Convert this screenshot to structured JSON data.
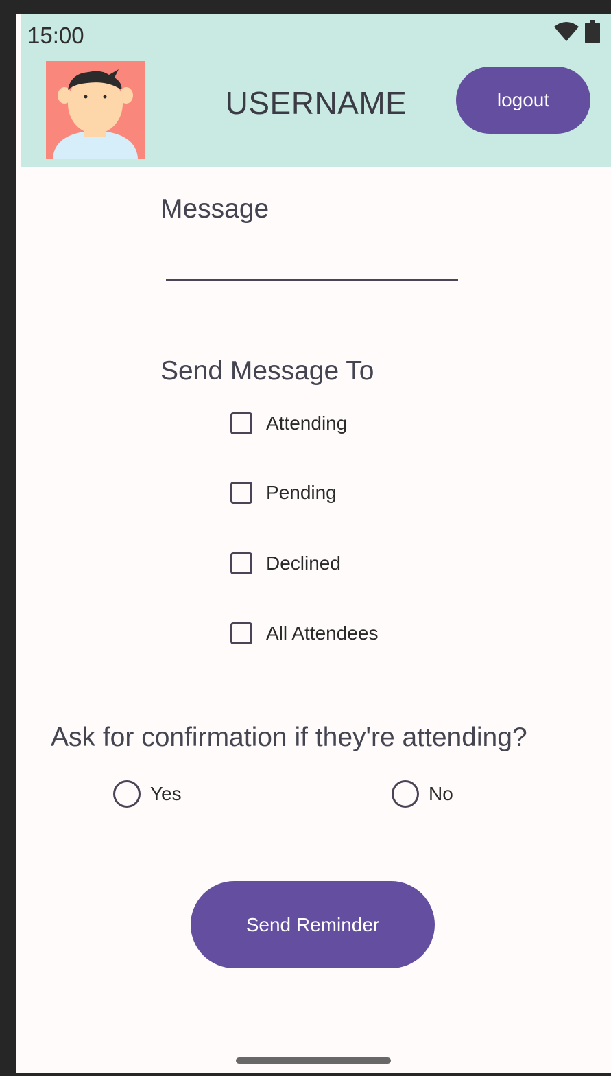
{
  "status_bar": {
    "time": "15:00",
    "icons": [
      "wifi-icon",
      "battery-icon"
    ]
  },
  "header": {
    "username": "USERNAME",
    "logout_label": "logout",
    "avatar": "avatar-icon"
  },
  "form": {
    "message_label": "Message",
    "message_value": "",
    "send_to_label": "Send Message To",
    "recipients": [
      {
        "label": "Attending",
        "checked": false
      },
      {
        "label": "Pending",
        "checked": false
      },
      {
        "label": "Declined",
        "checked": false
      },
      {
        "label": "All Attendees",
        "checked": false
      }
    ],
    "confirm_question": "Ask for confirmation if they're attending?",
    "confirm_options": [
      {
        "label": "Yes",
        "selected": false
      },
      {
        "label": "No",
        "selected": false
      }
    ],
    "send_label": "Send Reminder"
  },
  "colors": {
    "header_bg": "#c8eae3",
    "accent": "#644ea0",
    "screen_bg": "#fffbfa",
    "avatar_bg": "#f9877c"
  }
}
